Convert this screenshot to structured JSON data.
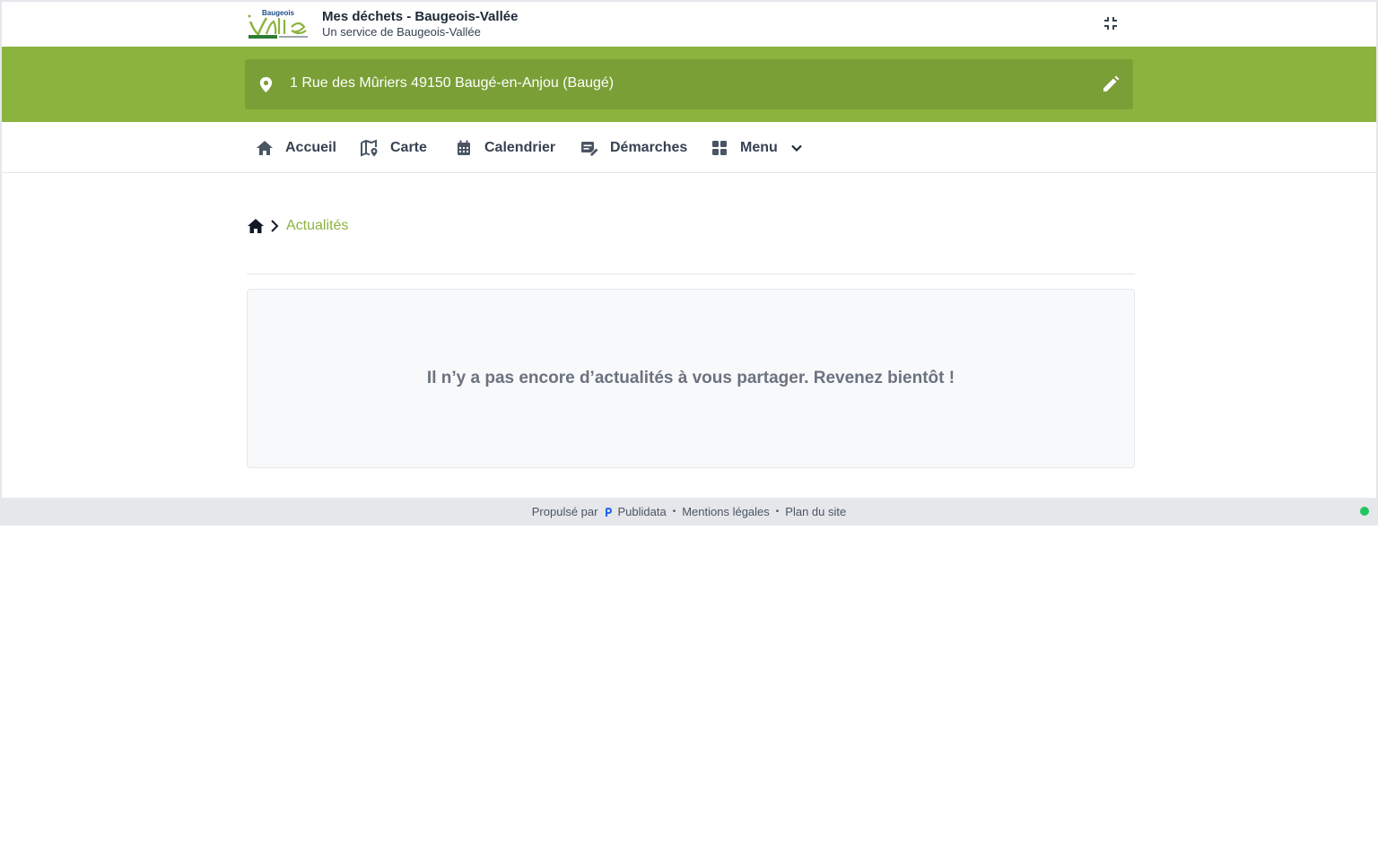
{
  "header": {
    "logo_text_top": "Baugeois",
    "logo_text_main": "Vallée",
    "title": "Mes déchets - Baugeois-Vallée",
    "subtitle": "Un service de Baugeois-Vallée",
    "collapse_icon": "collapse-icon"
  },
  "address": {
    "text": "1 Rue des Mûriers 49150 Baugé-en-Anjou (Baugé)",
    "pin_icon": "map-pin-icon",
    "edit_icon": "pencil-icon"
  },
  "nav": {
    "items": [
      {
        "label": "Accueil",
        "icon": "home-icon"
      },
      {
        "label": "Carte",
        "icon": "map-icon"
      },
      {
        "label": "Calendrier",
        "icon": "calendar-icon"
      },
      {
        "label": "Démarches",
        "icon": "form-edit-icon"
      },
      {
        "label": "Menu",
        "icon": "grid-icon",
        "dropdown_icon": "chevron-down-icon"
      }
    ]
  },
  "breadcrumb": {
    "home_icon": "home-icon",
    "separator_icon": "chevron-right-icon",
    "current": "Actualités"
  },
  "main": {
    "empty_message": "Il n’y a pas encore d’actualités à vous partager. Revenez bientôt !"
  },
  "footer": {
    "powered_by": "Propulsé par",
    "brand": "Publidata",
    "links": [
      "Mentions légales",
      "Plan du site"
    ],
    "separator": "•",
    "status_color": "#22c55e"
  },
  "colors": {
    "brand_green": "#8bb43f",
    "address_bar": "#7a9f36"
  }
}
